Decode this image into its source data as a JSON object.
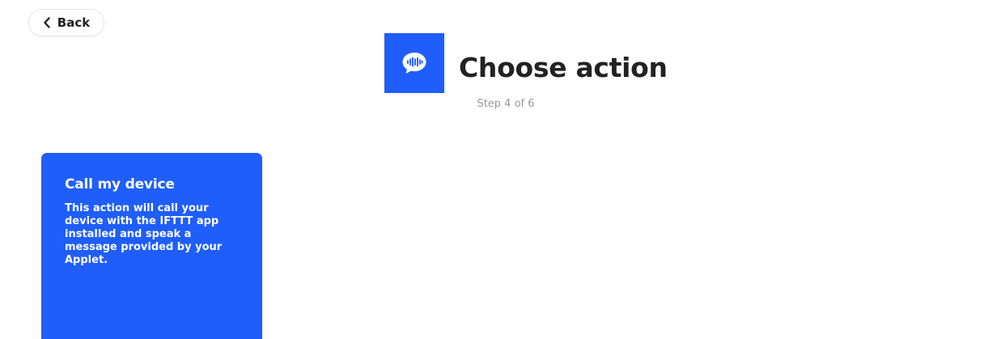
{
  "nav": {
    "back_label": "Back",
    "back_icon": "chevron-left-icon"
  },
  "header": {
    "service_icon": "speech-bubble-soundwave-icon",
    "service_color": "#1f5efa",
    "title": "Choose action",
    "step": "Step 4 of 6"
  },
  "actions": [
    {
      "title": "Call my device",
      "description": "This action will call your device with the IFTTT app installed and speak a message provided by your Applet.",
      "color": "#1f5efa"
    }
  ]
}
